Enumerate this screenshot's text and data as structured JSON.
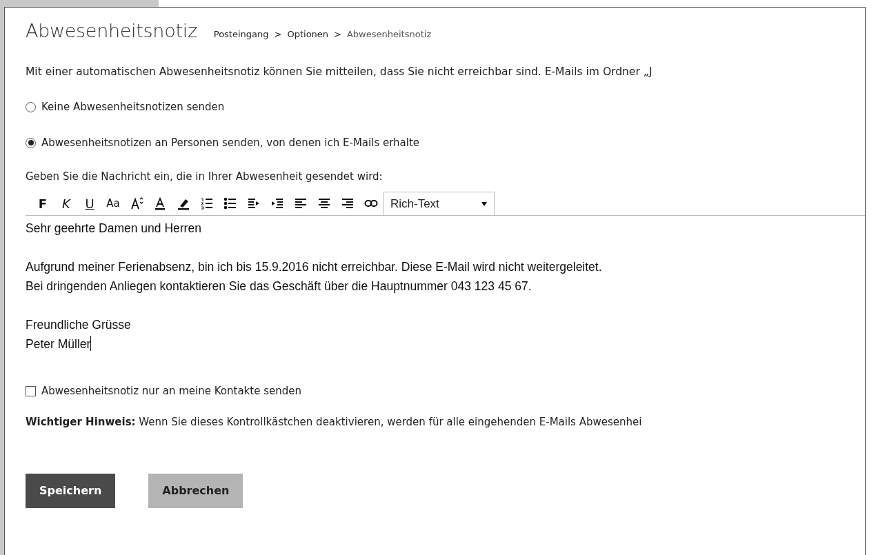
{
  "page": {
    "title": "Abwesenheitsnotiz"
  },
  "breadcrumb": [
    {
      "label": "Posteingang",
      "current": false
    },
    {
      "label": "Optionen",
      "current": false
    },
    {
      "label": "Abwesenheitsnotiz",
      "current": true
    }
  ],
  "breadcrumb_separator": ">",
  "intro": "Mit einer automatischen Abwesenheitsnotiz können Sie mitteilen, dass Sie nicht erreichbar sind. E-Mails im Ordner „J",
  "reply_options": [
    {
      "label": "Keine Abwesenheitsnotizen senden",
      "selected": false
    },
    {
      "label": "Abwesenheitsnotizen an Personen senden, von denen ich E-Mails erhalte",
      "selected": true
    }
  ],
  "message_prompt": "Geben Sie die Nachricht ein, die in Ihrer Abwesenheit gesendet wird:",
  "toolbar": [
    {
      "kind": "bold",
      "label": "F"
    },
    {
      "kind": "italic",
      "label": "K"
    },
    {
      "kind": "underline",
      "label": "U"
    },
    {
      "kind": "font",
      "label": "Aa"
    },
    {
      "kind": "size"
    },
    {
      "kind": "color"
    },
    {
      "kind": "highlight"
    },
    {
      "kind": "numbered"
    },
    {
      "kind": "bullets"
    },
    {
      "kind": "outdent"
    },
    {
      "kind": "indent"
    },
    {
      "kind": "left"
    },
    {
      "kind": "center"
    },
    {
      "kind": "right"
    },
    {
      "kind": "link"
    }
  ],
  "format_select": {
    "value": "Rich-Text"
  },
  "message_paragraphs": [
    [
      "Sehr geehrte Damen und Herren"
    ],
    [
      "Aufgrund meiner Ferienabsenz, bin ich bis 15.9.2016 nicht erreichbar. Diese E-Mail wird nicht weitergeleitet.",
      "Bei dringenden Anliegen kontaktieren Sie das Geschäft über die Hauptnummer 043 123 45 67."
    ],
    [
      "Freundliche Grüsse",
      "Peter Müller"
    ]
  ],
  "contacts_only": {
    "label": "Abwesenheitsnotiz nur an meine Kontakte senden",
    "checked": false
  },
  "note": "**Wichtiger Hinweis:** Wenn Sie dieses Kontrollkästchen deaktivieren, werden für alle eingehenden E-Mails Abwesenhei",
  "buttons": [
    {
      "label": "Speichern",
      "kind": "primary"
    },
    {
      "label": "Abbrechen",
      "kind": "secondary"
    }
  ]
}
